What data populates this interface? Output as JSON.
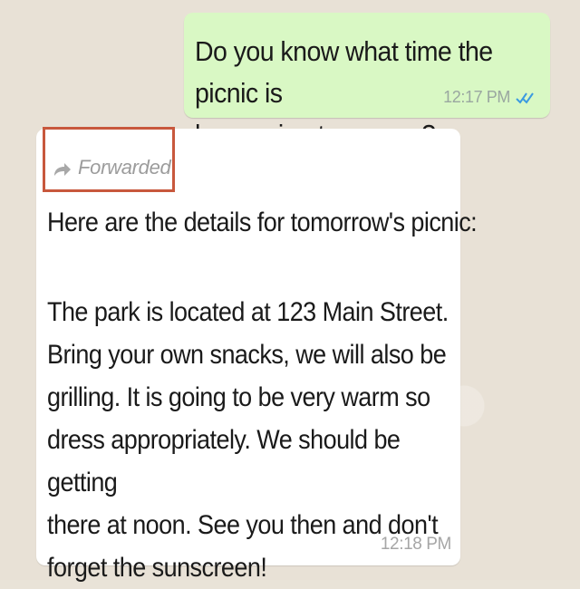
{
  "chat": {
    "outgoing": {
      "text": "Do you know what time the picnic is\nhappening tomorrow?",
      "time": "12:17 PM",
      "status_icon": "double-check-icon",
      "status_color": "#3b9ae1",
      "bubble_color": "#d9f8c4"
    },
    "incoming": {
      "forwarded_label": "Forwarded",
      "forward_icon": "forward-arrow-icon",
      "intro": "Here are the details for tomorrow's picnic:",
      "body": "The park is located at 123 Main Street.\nBring your own snacks, we will also be\ngrilling. It is going to be very warm so\ndress appropriately. We should be getting\nthere at noon. See you then and don't\nforget the sunscreen!",
      "time": "12:18 PM",
      "highlight_color": "#c8583d"
    }
  }
}
